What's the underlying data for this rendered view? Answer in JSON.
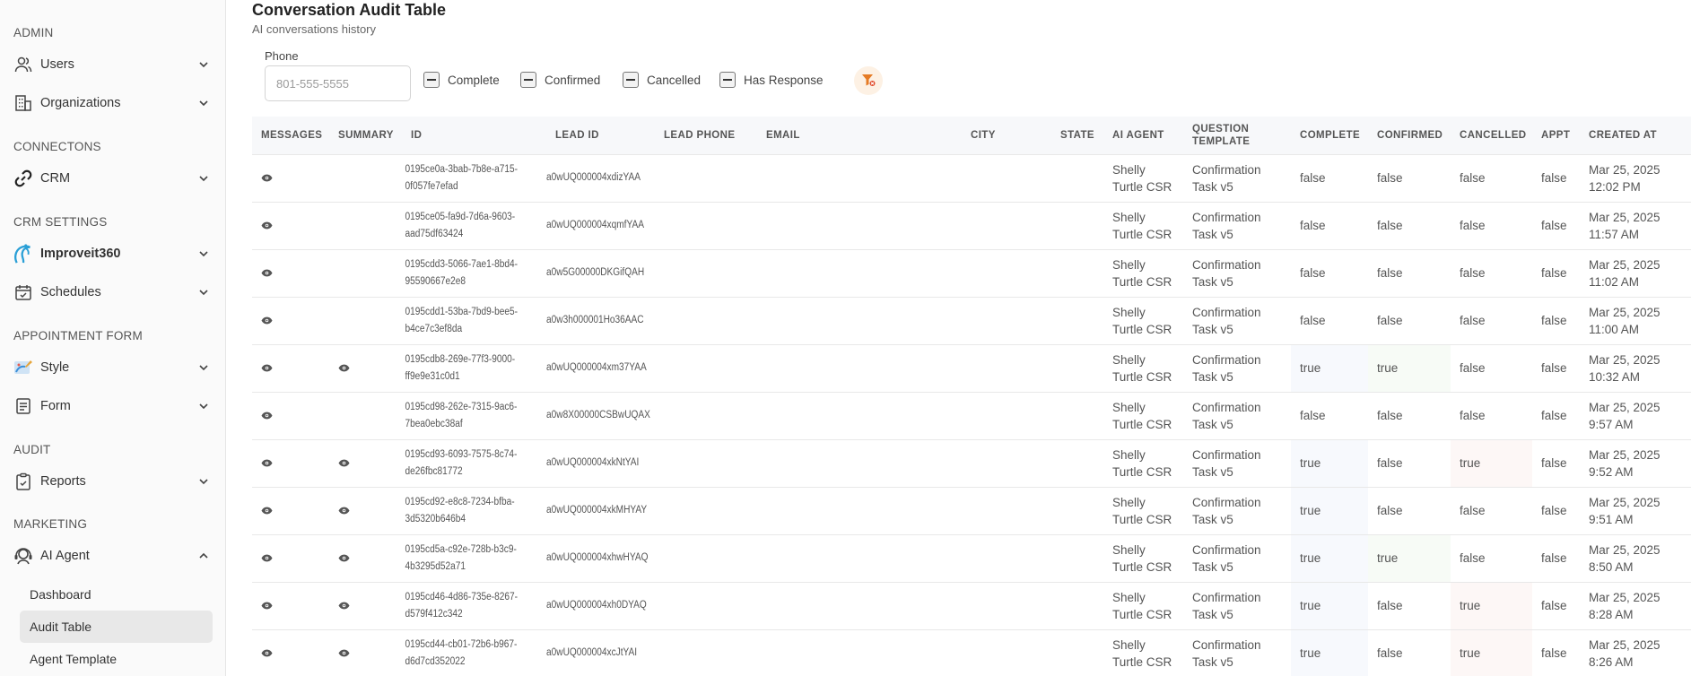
{
  "sidebar": {
    "sections": [
      {
        "label": "ADMIN"
      },
      {
        "label": "CONNECTONS"
      },
      {
        "label": "CRM SETTINGS"
      },
      {
        "label": "APPOINTMENT FORM"
      },
      {
        "label": "AUDIT"
      },
      {
        "label": "MARKETING"
      }
    ],
    "items": [
      {
        "label": "Users",
        "icon": "users-icon"
      },
      {
        "label": "Organizations",
        "icon": "building-icon"
      },
      {
        "label": "CRM",
        "icon": "link-icon"
      },
      {
        "label": "Improveit360",
        "icon": "improveit360-logo-icon"
      },
      {
        "label": "Schedules",
        "icon": "calendar-icon"
      },
      {
        "label": "Style",
        "icon": "palette-icon"
      },
      {
        "label": "Form",
        "icon": "form-icon"
      },
      {
        "label": "Reports",
        "icon": "clipboard-icon"
      },
      {
        "label": "AI Agent",
        "icon": "ai-agent-icon"
      }
    ],
    "subitems": [
      {
        "label": "Dashboard"
      },
      {
        "label": "Audit Table",
        "active": true
      },
      {
        "label": "Agent Template"
      }
    ]
  },
  "page": {
    "title": "Conversation Audit Table",
    "subtitle": "AI conversations history"
  },
  "filters": {
    "phone_label": "Phone",
    "phone_placeholder": "801-555-5555",
    "phone_value": "",
    "checkboxes": [
      {
        "label": "Complete",
        "state": "indeterminate"
      },
      {
        "label": "Confirmed",
        "state": "indeterminate"
      },
      {
        "label": "Cancelled",
        "state": "indeterminate"
      },
      {
        "label": "Has Response",
        "state": "indeterminate"
      }
    ],
    "clear_icon": "filter-clear-icon"
  },
  "table": {
    "columns": [
      "MESSAGES",
      "SUMMARY",
      "ID",
      "LEAD ID",
      "LEAD PHONE",
      "EMAIL",
      "CITY",
      "STATE",
      "AI AGENT",
      "QUESTION TEMPLATE",
      "COMPLETE",
      "CONFIRMED",
      "CANCELLED",
      "APPT",
      "CREATED AT"
    ],
    "rows": [
      {
        "summary": false,
        "id1": "0195ce0a-3bab-7b8e-a715-",
        "id2": "0f057fe7efad",
        "lead_id": "a0wUQ000004xdizYAA",
        "phone": "",
        "email": "",
        "city": "",
        "state": "",
        "agent1": "Shelly",
        "agent2": "Turtle CSR",
        "tpl1": "Confirmation",
        "tpl2": "Task v5",
        "complete": "false",
        "confirmed": "false",
        "cancelled": "false",
        "appt": "false",
        "created1": "Mar 25, 2025",
        "created2": "12:02 PM"
      },
      {
        "summary": false,
        "id1": "0195ce05-fa9d-7d6a-9603-",
        "id2": "aad75df63424",
        "lead_id": "a0wUQ000004xqmfYAA",
        "phone": "",
        "email": "",
        "city": "",
        "state": "",
        "agent1": "Shelly",
        "agent2": "Turtle CSR",
        "tpl1": "Confirmation",
        "tpl2": "Task v5",
        "complete": "false",
        "confirmed": "false",
        "cancelled": "false",
        "appt": "false",
        "created1": "Mar 25, 2025",
        "created2": "11:57 AM"
      },
      {
        "summary": false,
        "id1": "0195cdd3-5066-7ae1-8bd4-",
        "id2": "95590667e2e8",
        "lead_id": "a0w5G00000DKGifQAH",
        "phone": "",
        "email": "",
        "city": "",
        "state": "",
        "agent1": "Shelly",
        "agent2": "Turtle CSR",
        "tpl1": "Confirmation",
        "tpl2": "Task v5",
        "complete": "false",
        "confirmed": "false",
        "cancelled": "false",
        "appt": "false",
        "created1": "Mar 25, 2025",
        "created2": "11:02 AM"
      },
      {
        "summary": false,
        "id1": "0195cdd1-53ba-7bd9-bee5-",
        "id2": "b4ce7c3ef8da",
        "lead_id": "a0w3h000001Ho36AAC",
        "phone": "",
        "email": "",
        "city": "",
        "state": "",
        "agent1": "Shelly",
        "agent2": "Turtle CSR",
        "tpl1": "Confirmation",
        "tpl2": "Task v5",
        "complete": "false",
        "confirmed": "false",
        "cancelled": "false",
        "appt": "false",
        "created1": "Mar 25, 2025",
        "created2": "11:00 AM"
      },
      {
        "summary": true,
        "id1": "0195cdb8-269e-77f3-9000-",
        "id2": "ff9e9e31c0d1",
        "lead_id": "a0wUQ000004xm37YAA",
        "phone": "",
        "email": "",
        "city": "",
        "state": "",
        "agent1": "Shelly",
        "agent2": "Turtle CSR",
        "tpl1": "Confirmation",
        "tpl2": "Task v5",
        "complete": "true",
        "confirmed": "true",
        "cancelled": "false",
        "appt": "false",
        "created1": "Mar 25, 2025",
        "created2": "10:32 AM"
      },
      {
        "summary": false,
        "id1": "0195cd98-262e-7315-9ac6-",
        "id2": "7bea0ebc38af",
        "lead_id": "a0w8X00000CSBwUQAX",
        "phone": "",
        "email": "",
        "city": "",
        "state": "",
        "agent1": "Shelly",
        "agent2": "Turtle CSR",
        "tpl1": "Confirmation",
        "tpl2": "Task v5",
        "complete": "false",
        "confirmed": "false",
        "cancelled": "false",
        "appt": "false",
        "created1": "Mar 25, 2025",
        "created2": "9:57 AM"
      },
      {
        "summary": true,
        "id1": "0195cd93-6093-7575-8c74-",
        "id2": "de26fbc81772",
        "lead_id": "a0wUQ000004xkNtYAI",
        "phone": "",
        "email": "",
        "city": "",
        "state": "",
        "agent1": "Shelly",
        "agent2": "Turtle CSR",
        "tpl1": "Confirmation",
        "tpl2": "Task v5",
        "complete": "true",
        "confirmed": "false",
        "cancelled": "true",
        "appt": "false",
        "created1": "Mar 25, 2025",
        "created2": "9:52 AM"
      },
      {
        "summary": true,
        "id1": "0195cd92-e8c8-7234-bfba-",
        "id2": "3d5320b646b4",
        "lead_id": "a0wUQ000004xkMHYAY",
        "phone": "",
        "email": "",
        "city": "",
        "state": "",
        "agent1": "Shelly",
        "agent2": "Turtle CSR",
        "tpl1": "Confirmation",
        "tpl2": "Task v5",
        "complete": "true",
        "confirmed": "false",
        "cancelled": "false",
        "appt": "false",
        "created1": "Mar 25, 2025",
        "created2": "9:51 AM"
      },
      {
        "summary": true,
        "id1": "0195cd5a-c92e-728b-b3c9-",
        "id2": "4b3295d52a71",
        "lead_id": "a0wUQ000004xhwHYAQ",
        "phone": "",
        "email": "",
        "city": "",
        "state": "",
        "agent1": "Shelly",
        "agent2": "Turtle CSR",
        "tpl1": "Confirmation",
        "tpl2": "Task v5",
        "complete": "true",
        "confirmed": "true",
        "cancelled": "false",
        "appt": "false",
        "created1": "Mar 25, 2025",
        "created2": "8:50 AM"
      },
      {
        "summary": true,
        "id1": "0195cd46-4d86-735e-8267-",
        "id2": "d579f412c342",
        "lead_id": "a0wUQ000004xh0DYAQ",
        "phone": "",
        "email": "",
        "city": "",
        "state": "",
        "agent1": "Shelly",
        "agent2": "Turtle CSR",
        "tpl1": "Confirmation",
        "tpl2": "Task v5",
        "complete": "true",
        "confirmed": "false",
        "cancelled": "true",
        "appt": "false",
        "created1": "Mar 25, 2025",
        "created2": "8:28 AM"
      },
      {
        "summary": true,
        "id1": "0195cd44-cb01-72b6-b967-",
        "id2": "d6d7cd352022",
        "lead_id": "a0wUQ000004xcJtYAI",
        "phone": "",
        "email": "",
        "city": "",
        "state": "",
        "agent1": "Shelly",
        "agent2": "Turtle CSR",
        "tpl1": "Confirmation",
        "tpl2": "Task v5",
        "complete": "true",
        "confirmed": "false",
        "cancelled": "true",
        "appt": "false",
        "created1": "Mar 25, 2025",
        "created2": "8:26 AM"
      }
    ]
  }
}
